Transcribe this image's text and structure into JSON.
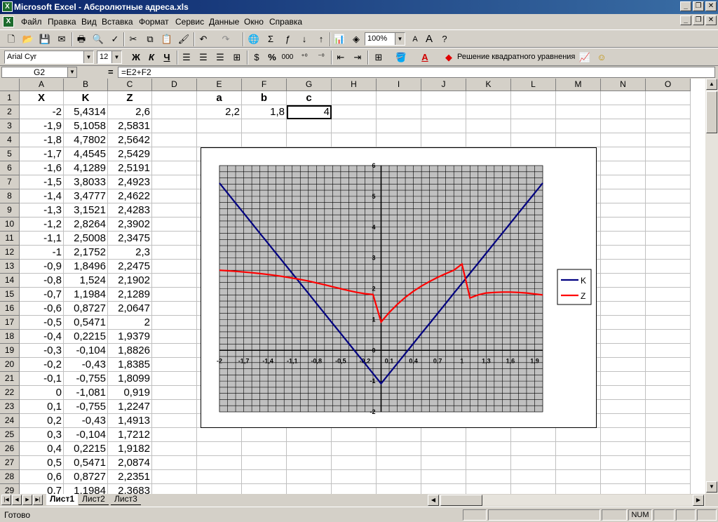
{
  "window": {
    "title": "Microsoft Excel - Абсролютные адреса.xls"
  },
  "menu": [
    "Файл",
    "Правка",
    "Вид",
    "Вставка",
    "Формат",
    "Сервис",
    "Данные",
    "Окно",
    "Справка"
  ],
  "toolbar": {
    "zoom": "100%",
    "font": "Arial Cyr",
    "font_size": "12",
    "bold": "Ж",
    "italic": "К",
    "underline": "Ч",
    "percent": "%",
    "thousands": "000",
    "macro_label": "Решение квадратного уравнения"
  },
  "formula_bar": {
    "cell_ref": "G2",
    "eq": "=",
    "formula": "=E2+F2"
  },
  "columns": [
    "A",
    "B",
    "C",
    "D",
    "E",
    "F",
    "G",
    "H",
    "I",
    "J",
    "K",
    "L",
    "M",
    "N",
    "O"
  ],
  "headers": {
    "X": "X",
    "K": "K",
    "Z": "Z",
    "a": "a",
    "b": "b",
    "c": "c"
  },
  "params": {
    "a": "2,2",
    "b": "1,8",
    "c": "4"
  },
  "rows": [
    [
      "-2",
      "5,4314",
      "2,6"
    ],
    [
      "-1,9",
      "5,1058",
      "2,5831"
    ],
    [
      "-1,8",
      "4,7802",
      "2,5642"
    ],
    [
      "-1,7",
      "4,4545",
      "2,5429"
    ],
    [
      "-1,6",
      "4,1289",
      "2,5191"
    ],
    [
      "-1,5",
      "3,8033",
      "2,4923"
    ],
    [
      "-1,4",
      "3,4777",
      "2,4622"
    ],
    [
      "-1,3",
      "3,1521",
      "2,4283"
    ],
    [
      "-1,2",
      "2,8264",
      "2,3902"
    ],
    [
      "-1,1",
      "2,5008",
      "2,3475"
    ],
    [
      "-1",
      "2,1752",
      "2,3"
    ],
    [
      "-0,9",
      "1,8496",
      "2,2475"
    ],
    [
      "-0,8",
      "1,524",
      "2,1902"
    ],
    [
      "-0,7",
      "1,1984",
      "2,1289"
    ],
    [
      "-0,6",
      "0,8727",
      "2,0647"
    ],
    [
      "-0,5",
      "0,5471",
      "2"
    ],
    [
      "-0,4",
      "0,2215",
      "1,9379"
    ],
    [
      "-0,3",
      "-0,104",
      "1,8826"
    ],
    [
      "-0,2",
      "-0,43",
      "1,8385"
    ],
    [
      "-0,1",
      "-0,755",
      "1,8099"
    ],
    [
      "0",
      "-1,081",
      "0,919"
    ],
    [
      "0,1",
      "-0,755",
      "1,2247"
    ],
    [
      "0,2",
      "-0,43",
      "1,4913"
    ],
    [
      "0,3",
      "-0,104",
      "1,7212"
    ],
    [
      "0,4",
      "0,2215",
      "1,9182"
    ],
    [
      "0,5",
      "0,5471",
      "2,0874"
    ],
    [
      "0,6",
      "0,8727",
      "2,2351"
    ],
    [
      "0,7",
      "1,1984",
      "2,3683"
    ]
  ],
  "chart_data": {
    "type": "line",
    "x_tick_labels": [
      "-2",
      "-1,7",
      "-1,4",
      "-1,1",
      "-0,8",
      "-0,5",
      "-0,2",
      "0,1",
      "0,4",
      "0,7",
      "1",
      "1,3",
      "1,6",
      "1,9"
    ],
    "y_tick_labels": [
      "-2",
      "-1",
      "0",
      "1",
      "2",
      "3",
      "4",
      "5",
      "6"
    ],
    "xlim": [
      -2,
      2
    ],
    "ylim": [
      -2,
      6
    ],
    "legend_position": "right",
    "series": [
      {
        "name": "K",
        "color": "#000080",
        "x": [
          -2,
          -1.9,
          -1.8,
          -1.7,
          -1.6,
          -1.5,
          -1.4,
          -1.3,
          -1.2,
          -1.1,
          -1,
          -0.9,
          -0.8,
          -0.7,
          -0.6,
          -0.5,
          -0.4,
          -0.3,
          -0.2,
          -0.1,
          0,
          0.1,
          0.2,
          0.3,
          0.4,
          0.5,
          0.6,
          0.7,
          0.8,
          0.9,
          1,
          1.1,
          1.2,
          1.3,
          1.4,
          1.5,
          1.6,
          1.7,
          1.8,
          1.9,
          2
        ],
        "values": [
          5.4314,
          5.1058,
          4.7802,
          4.4545,
          4.1289,
          3.8033,
          3.4777,
          3.1521,
          2.8264,
          2.5008,
          2.1752,
          1.8496,
          1.524,
          1.1984,
          0.8727,
          0.5471,
          0.2215,
          -0.104,
          -0.43,
          -0.755,
          -1.081,
          -0.755,
          -0.43,
          -0.104,
          0.2215,
          0.5471,
          0.8727,
          1.1984,
          1.524,
          1.8496,
          2.1752,
          2.5008,
          2.8264,
          3.1521,
          3.4777,
          3.8033,
          4.1289,
          4.4545,
          4.7802,
          5.1058,
          5.4314
        ]
      },
      {
        "name": "Z",
        "color": "#ff0000",
        "x": [
          -2,
          -1.9,
          -1.8,
          -1.7,
          -1.6,
          -1.5,
          -1.4,
          -1.3,
          -1.2,
          -1.1,
          -1,
          -0.9,
          -0.8,
          -0.7,
          -0.6,
          -0.5,
          -0.4,
          -0.3,
          -0.2,
          -0.1,
          0,
          0.1,
          0.2,
          0.3,
          0.4,
          0.5,
          0.6,
          0.7,
          0.8,
          0.9,
          1,
          1.1,
          1.2,
          1.3,
          1.4,
          1.5,
          1.6,
          1.7,
          1.8,
          1.9,
          2
        ],
        "values": [
          2.6,
          2.5831,
          2.5642,
          2.5429,
          2.5191,
          2.4923,
          2.4622,
          2.4283,
          2.3902,
          2.3475,
          2.3,
          2.2475,
          2.1902,
          2.1289,
          2.0647,
          2,
          1.9379,
          1.8826,
          1.8385,
          1.8099,
          0.919,
          1.2247,
          1.4913,
          1.7212,
          1.9182,
          2.0874,
          2.2351,
          2.3683,
          2.49,
          2.6,
          2.8,
          1.7,
          1.8,
          1.86,
          1.88,
          1.89,
          1.89,
          1.88,
          1.86,
          1.83,
          1.8
        ]
      }
    ]
  },
  "sheet_tabs": [
    "Лист1",
    "Лист2",
    "Лист3"
  ],
  "status": {
    "text": "Готово",
    "num": "NUM"
  }
}
